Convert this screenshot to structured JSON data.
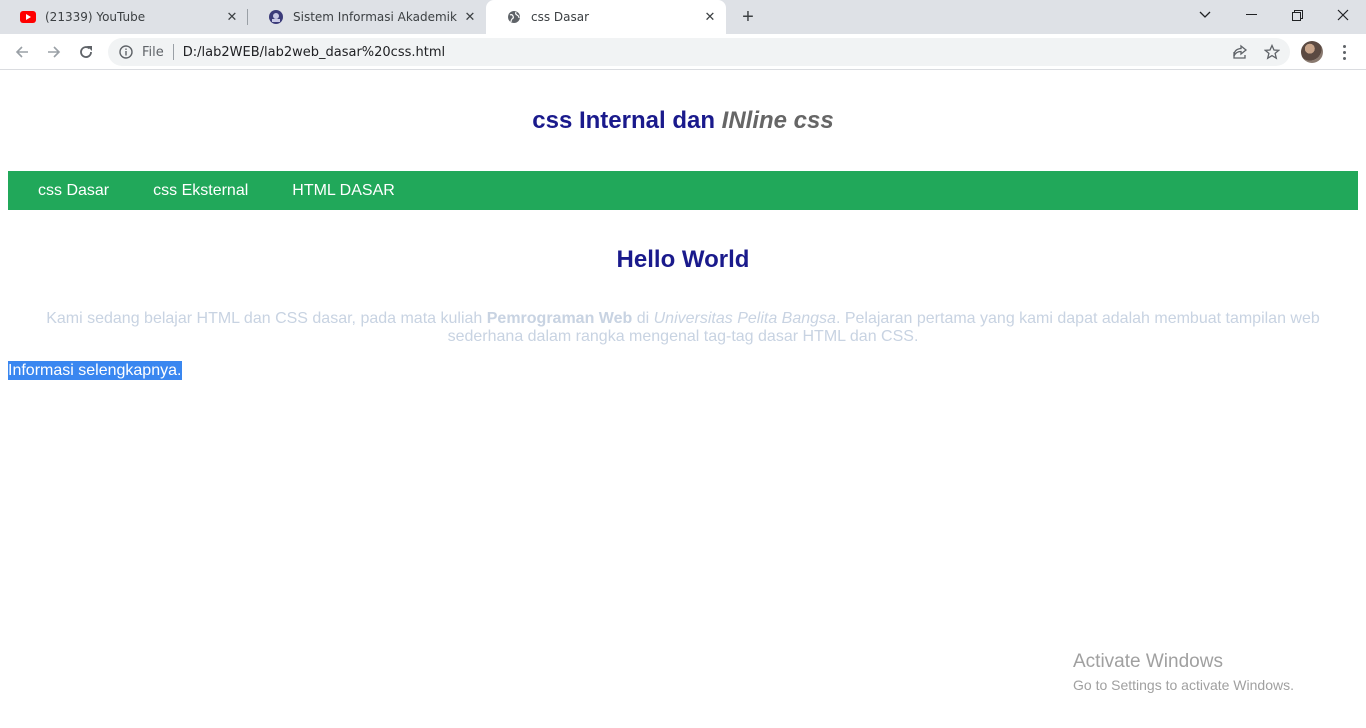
{
  "browser": {
    "tabs": [
      {
        "title": "(21339) YouTube",
        "icon": "youtube-icon",
        "active": false
      },
      {
        "title": "Sistem Informasi Akademik",
        "icon": "university-icon",
        "active": false
      },
      {
        "title": "css Dasar",
        "icon": "globe-icon",
        "active": true
      }
    ],
    "address": {
      "scheme": "File",
      "url": "D:/lab2WEB/lab2web_dasar%20css.html"
    }
  },
  "page": {
    "title_main": "css Internal dan",
    "title_italic": "INline css",
    "nav": [
      {
        "label": "css Dasar"
      },
      {
        "label": "css Eksternal"
      },
      {
        "label": "HTML DASAR"
      }
    ],
    "heading": "Hello World",
    "paragraph": {
      "part1": "Kami sedang belajar HTML dan CSS dasar, pada mata kuliah ",
      "bold": "Pemrograman Web",
      "part2": " di ",
      "italic": "Universitas Pelita Bangsa",
      "part3": ". Pelajaran pertama yang kami dapat adalah membuat tampilan web sederhana dalam rangka mengenal tag-tag dasar HTML dan CSS."
    },
    "more_link": "Informasi selengkapnya."
  },
  "watermark": {
    "line1": "Activate Windows",
    "line2": "Go to Settings to activate Windows."
  },
  "colors": {
    "nav_bg": "#21a85a",
    "heading": "#1a1a8c",
    "paragraph": "#c8d3e2",
    "selection": "#3a87f0"
  }
}
